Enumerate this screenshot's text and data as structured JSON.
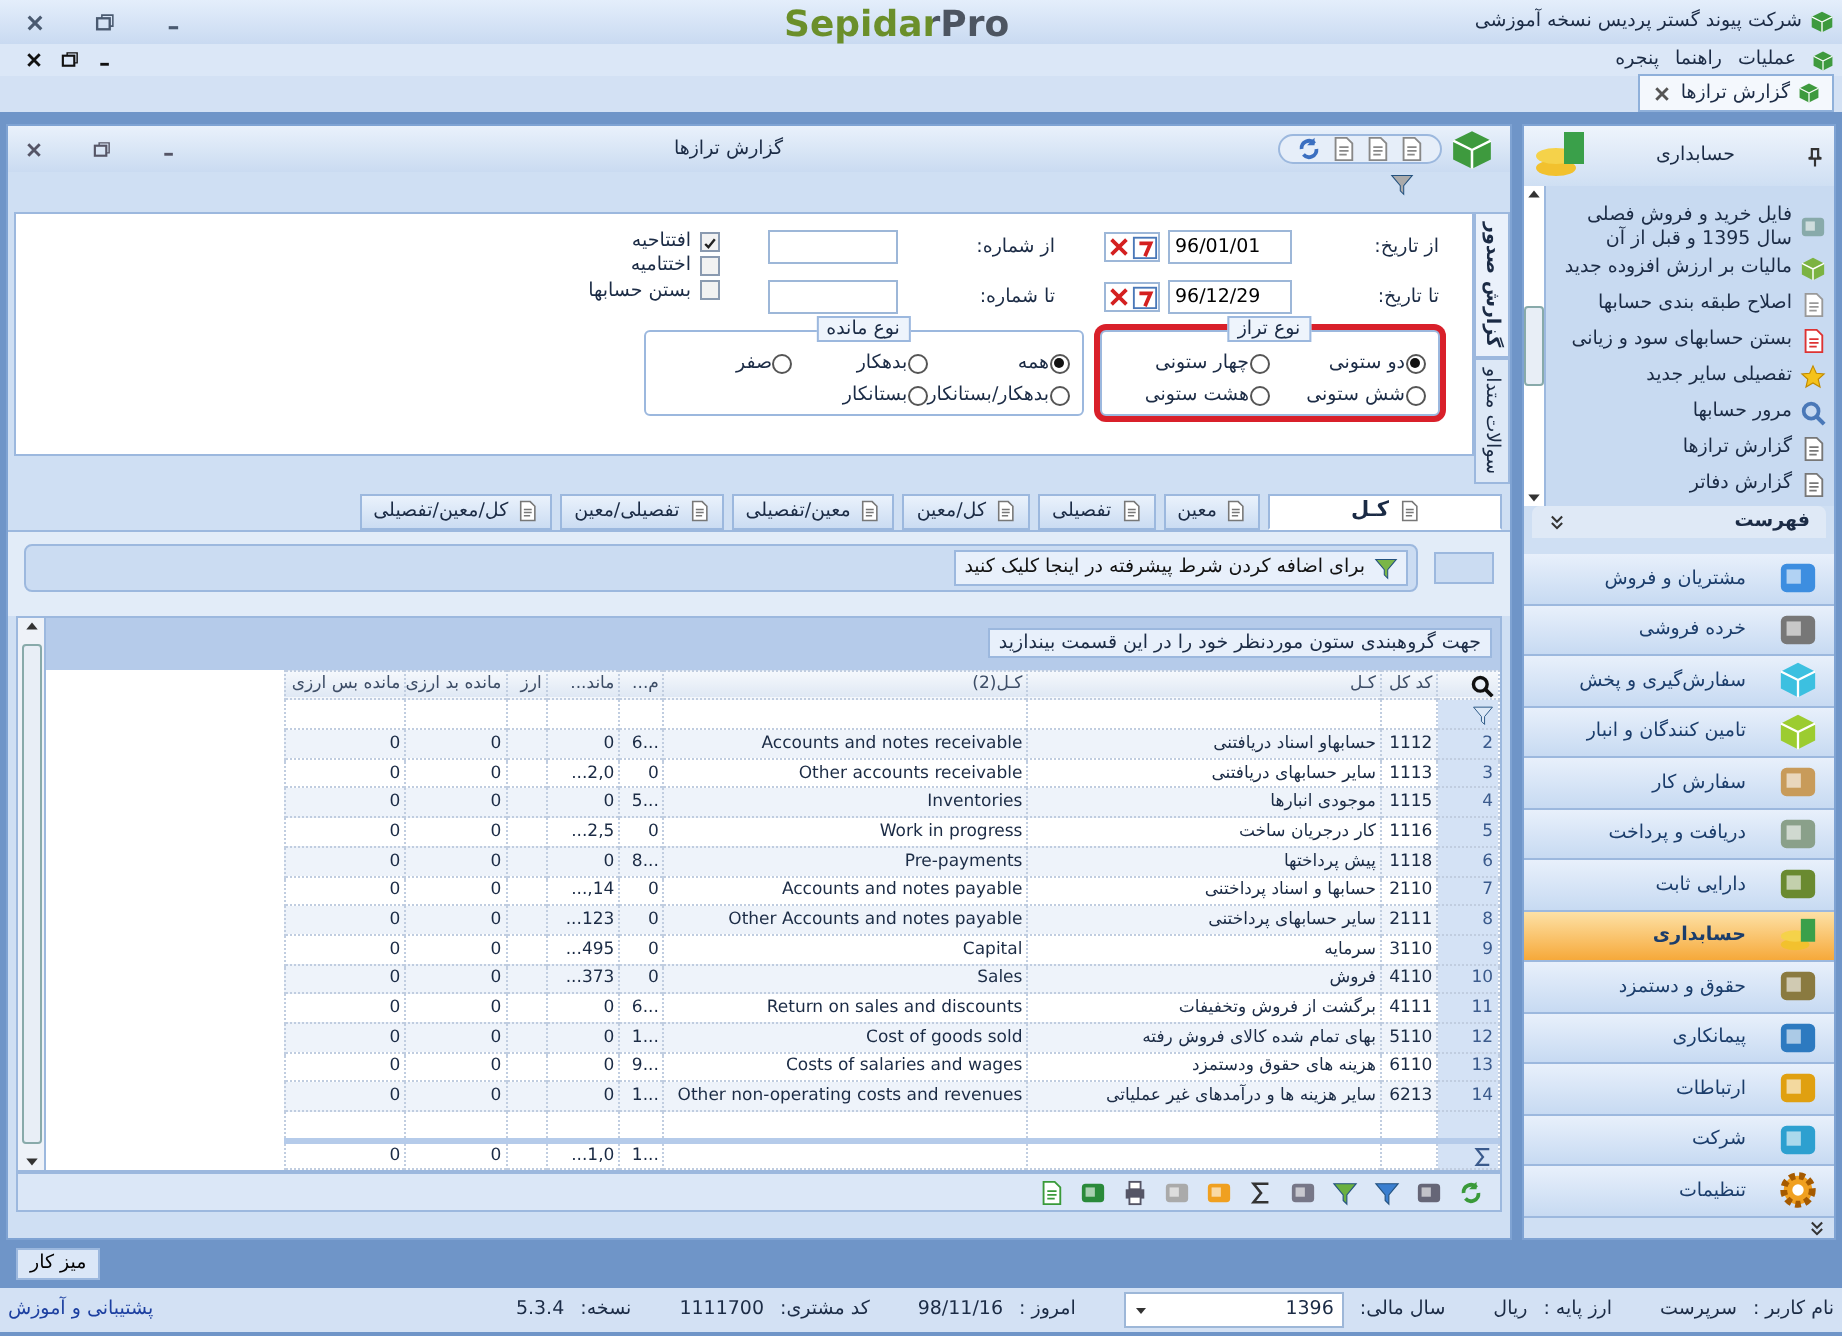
{
  "app": {
    "title": "شرکت پیوند گستر پردیس نسخه آموزشی",
    "logo": "SepidarPro"
  },
  "menu": [
    "عملیات",
    "راهنما",
    "پنجره"
  ],
  "doc_tabs": [
    {
      "label": "گزارش ترازها",
      "selected": true
    }
  ],
  "report": {
    "title": "گزارش ترازها",
    "side_tabs": [
      {
        "label": "گزارش صدور",
        "selected": true
      },
      {
        "label": "سوالات متداو",
        "selected": false
      }
    ],
    "dates": [
      {
        "label": "از تاریخ:",
        "value": "96/01/01"
      },
      {
        "label": "تا تاریخ:",
        "value": "96/12/29"
      }
    ],
    "numbers": [
      {
        "label": "از شماره:"
      },
      {
        "label": "تا شماره:"
      }
    ],
    "checks": [
      {
        "label": "افتتاحیه",
        "checked": true
      },
      {
        "label": "اختتامیه",
        "checked": false
      },
      {
        "label": "بستن حسابها",
        "checked": false
      }
    ],
    "balance_type": {
      "title": "نوع تراز",
      "highlighted": true,
      "options": [
        {
          "label": "دو ستونی",
          "selected": true
        },
        {
          "label": "چهار ستونی",
          "selected": false
        },
        {
          "label": "شش ستونی",
          "selected": false
        },
        {
          "label": "هشت ستونی",
          "selected": false
        }
      ]
    },
    "remainder_type": {
      "title": "نوع مانده",
      "highlighted": false,
      "options": [
        {
          "label": "همه",
          "selected": true
        },
        {
          "label": "بدهکار",
          "selected": false
        },
        {
          "label": "صفر",
          "selected": false
        },
        {
          "label": "بدهکار/بستانکار",
          "selected": false
        },
        {
          "label": "بستانکار",
          "selected": false
        }
      ]
    },
    "tabs": [
      {
        "label": "کـل",
        "selected": true
      },
      {
        "label": "معین",
        "selected": false
      },
      {
        "label": "تفصیلی",
        "selected": false
      },
      {
        "label": "کل/معین",
        "selected": false
      },
      {
        "label": "معین/تفصیلی",
        "selected": false
      },
      {
        "label": "تفصیلی/معین",
        "selected": false
      },
      {
        "label": "کل/معین/تفصیلی",
        "selected": false
      }
    ],
    "advanced_filter": "برای اضافه کردن شرط پیشرفته در اینجا کلیک کنید",
    "group_hint": "جهت گروهبندی ستون موردنظر خود را در این قسمت بیندازید",
    "table": {
      "columns": [
        "",
        "کد کل",
        "کـل",
        "کـل(2)",
        "م...",
        "ماند...",
        "ارز",
        "مانده بد ارزی",
        "مانده بس ارزی"
      ],
      "rows": [
        {
          "kind": "data",
          "cells": [
            "2",
            "1112",
            "حسابهاو اسناد دریافتنی",
            "Accounts and notes receivable",
            "6...",
            "0",
            "",
            "0",
            "0"
          ]
        },
        {
          "kind": "data",
          "cells": [
            "3",
            "1113",
            "سایر حسابهای دریافتنی",
            "Other accounts receivable",
            "0",
            "...2,0",
            "",
            "0",
            "0"
          ]
        },
        {
          "kind": "data",
          "cells": [
            "4",
            "1115",
            "موجودی انبارها",
            "Inventories",
            "5...",
            "0",
            "",
            "0",
            "0"
          ]
        },
        {
          "kind": "data",
          "cells": [
            "5",
            "1116",
            "کار درجریان ساخت",
            "Work in progress",
            "0",
            "...2,5",
            "",
            "0",
            "0"
          ]
        },
        {
          "kind": "data",
          "cells": [
            "6",
            "1118",
            "پیش پرداختها",
            "Pre-payments",
            "8...",
            "0",
            "",
            "0",
            "0"
          ]
        },
        {
          "kind": "data",
          "cells": [
            "7",
            "2110",
            "حسابها و اسناد پرداختنی",
            "Accounts and notes payable",
            "0",
            "...,14",
            "",
            "0",
            "0"
          ]
        },
        {
          "kind": "data",
          "cells": [
            "8",
            "2111",
            "سایر حسابهای پرداختنی",
            "Other Accounts and notes payable",
            "0",
            "...123",
            "",
            "0",
            "0"
          ]
        },
        {
          "kind": "data",
          "cells": [
            "9",
            "3110",
            "سرمایه",
            "Capital",
            "0",
            "...495",
            "",
            "0",
            "0"
          ]
        },
        {
          "kind": "data",
          "cells": [
            "10",
            "4110",
            "فروش",
            "Sales",
            "0",
            "...373",
            "",
            "0",
            "0"
          ]
        },
        {
          "kind": "data",
          "cells": [
            "11",
            "4111",
            "برگشت از فروش وتخفیفات",
            "Return on sales and discounts",
            "6...",
            "0",
            "",
            "0",
            "0"
          ]
        },
        {
          "kind": "data",
          "cells": [
            "12",
            "5110",
            "بهای تمام شده کالای فروش رفته",
            "Cost of goods sold",
            "1...",
            "0",
            "",
            "0",
            "0"
          ]
        },
        {
          "kind": "data",
          "cells": [
            "13",
            "6110",
            "هزینه های  حقوق ودستمزد",
            "Costs of salaries and wages",
            "9...",
            "0",
            "",
            "0",
            "0"
          ]
        },
        {
          "kind": "data",
          "cells": [
            "14",
            "6213",
            "سایر هزینه ها و درآمدهای غیر عملیاتی",
            "Other non-operating costs and revenues",
            "1...",
            "0",
            "",
            "0",
            "0"
          ]
        },
        {
          "kind": "total",
          "cells": [
            "",
            "",
            "",
            "",
            "1...",
            "...1,0",
            "",
            "0",
            "0"
          ]
        }
      ]
    }
  },
  "sidebar": {
    "title": "حسابداری",
    "items": [
      "فایل خرید و فروش فصلی سال 1395 و قبل از آن",
      "مالیات بر ارزش افزوده جدید",
      "اصلاح طبقه بندی حسابها",
      "بستن حسابهای سود و زیانی",
      "تفصیلی سایر جدید",
      "مرور حسابها",
      "گزارش ترازها",
      "گزارش دفاتر"
    ],
    "list_title": "فهرست",
    "modules": [
      {
        "label": "مشتریان و فروش",
        "selected": false
      },
      {
        "label": "خرده فروشی",
        "selected": false
      },
      {
        "label": "سفارش‌گیری و پخش",
        "selected": false
      },
      {
        "label": "تامین کنندگان و انبار",
        "selected": false
      },
      {
        "label": "سفارش کار",
        "selected": false
      },
      {
        "label": "دریافت و پرداخت",
        "selected": false
      },
      {
        "label": "دارایی ثابت",
        "selected": false
      },
      {
        "label": "حسابداری",
        "selected": true
      },
      {
        "label": "حقوق و دستمزد",
        "selected": false
      },
      {
        "label": "پیمانکاری",
        "selected": false
      },
      {
        "label": "ارتباطات",
        "selected": false
      },
      {
        "label": "شرکت",
        "selected": false
      },
      {
        "label": "تنظیمات",
        "selected": false
      }
    ]
  },
  "taskbar": [
    "میز کار"
  ],
  "status": [
    {
      "label": "نام کاربر :",
      "value": "سرپرست"
    },
    {
      "label": "ارز پایه :",
      "value": "ریال"
    },
    {
      "label": "سال مالی:",
      "value": "1396",
      "kind": "dropdown"
    },
    {
      "label": "امروز :",
      "value": "98/11/16"
    },
    {
      "label": "کد مشتری:",
      "value": "1111700"
    },
    {
      "label": "نسخه:",
      "value": "5.3.4"
    }
  ],
  "support_link": "پشتیبانی و آموزش"
}
